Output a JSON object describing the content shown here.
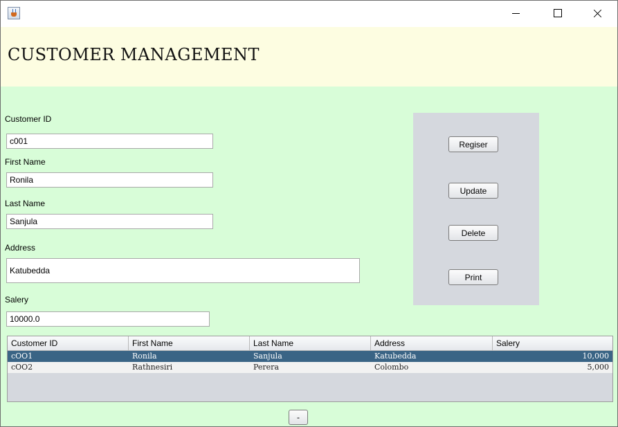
{
  "window": {
    "app_icon": "java-cup-icon",
    "controls": {
      "minimize": "minimize-icon",
      "maximize": "maximize-icon",
      "close": "close-icon"
    }
  },
  "header": {
    "title": "CUSTOMER MANAGEMENT"
  },
  "form": {
    "customer_id": {
      "label": "Customer ID",
      "value": "c001"
    },
    "first_name": {
      "label": "First Name",
      "value": "Ronila"
    },
    "last_name": {
      "label": "Last Name",
      "value": "Sanjula"
    },
    "address": {
      "label": "Address",
      "value": "Katubedda"
    },
    "salary": {
      "label": "Salery",
      "value": "10000.0"
    }
  },
  "buttons": {
    "register": "Regiser",
    "update": "Update",
    "delete": "Delete",
    "print": "Print",
    "small": "-"
  },
  "table": {
    "columns": [
      "Customer ID",
      "First Name",
      "Last Name",
      "Address",
      "Salery"
    ],
    "rows": [
      [
        "cOO1",
        "Ronila",
        "Sanjula",
        "Katubedda",
        "10,000"
      ],
      [
        "cOO2",
        "Rathnesiri",
        "Perera",
        "Colombo",
        "5,000"
      ]
    ],
    "selected_row": 0
  },
  "colors": {
    "header_bg": "#fdfde1",
    "body_bg": "#d8fdd8",
    "panel_bg": "#d5d8de",
    "selection": "#3a6485"
  }
}
